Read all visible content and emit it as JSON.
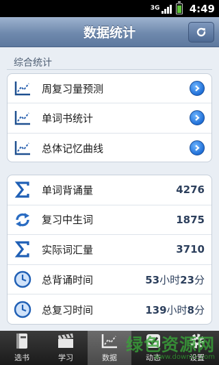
{
  "status_bar": {
    "network": "3G",
    "time": "4:49"
  },
  "header": {
    "title": "数据统计",
    "refresh_icon": "refresh-icon"
  },
  "section": {
    "label": "综合统计"
  },
  "stats_links": [
    {
      "label": "周复习量预测",
      "icon": "trend-chart-icon"
    },
    {
      "label": "单词书统计",
      "icon": "trend-chart-icon"
    },
    {
      "label": "总体记忆曲线",
      "icon": "trend-chart-icon"
    }
  ],
  "summary": [
    {
      "label": "单词背诵量",
      "value": "4276",
      "icon": "sigma-icon"
    },
    {
      "label": "复习中生词",
      "value": "1875",
      "icon": "sync-icon"
    },
    {
      "label": "实际词汇量",
      "value": "3710",
      "icon": "sigma-icon"
    },
    {
      "label": "总背诵时间",
      "value_a": "53",
      "unit_a": "小时",
      "value_b": "23",
      "unit_b": "分",
      "icon": "clock-icon"
    },
    {
      "label": "总复习时间",
      "value_a": "139",
      "unit_a": "小时",
      "value_b": "8",
      "unit_b": "分",
      "icon": "clock-icon"
    }
  ],
  "tabs": [
    {
      "label": "选书",
      "icon": "book-icon"
    },
    {
      "label": "学习",
      "icon": "clapperboard-icon"
    },
    {
      "label": "数据",
      "icon": "chart-icon",
      "active": true
    },
    {
      "label": "动态",
      "icon": "check-icon"
    },
    {
      "label": "设置",
      "icon": "gear-icon"
    }
  ],
  "watermark": {
    "text": "绿色资源网",
    "url": "www.downcc.com"
  },
  "colors": {
    "header": "#6f89ad",
    "accent_blue": "#1f6ed6",
    "value_text": "#2c3f5c",
    "tabbar": "#1b1b1b"
  }
}
